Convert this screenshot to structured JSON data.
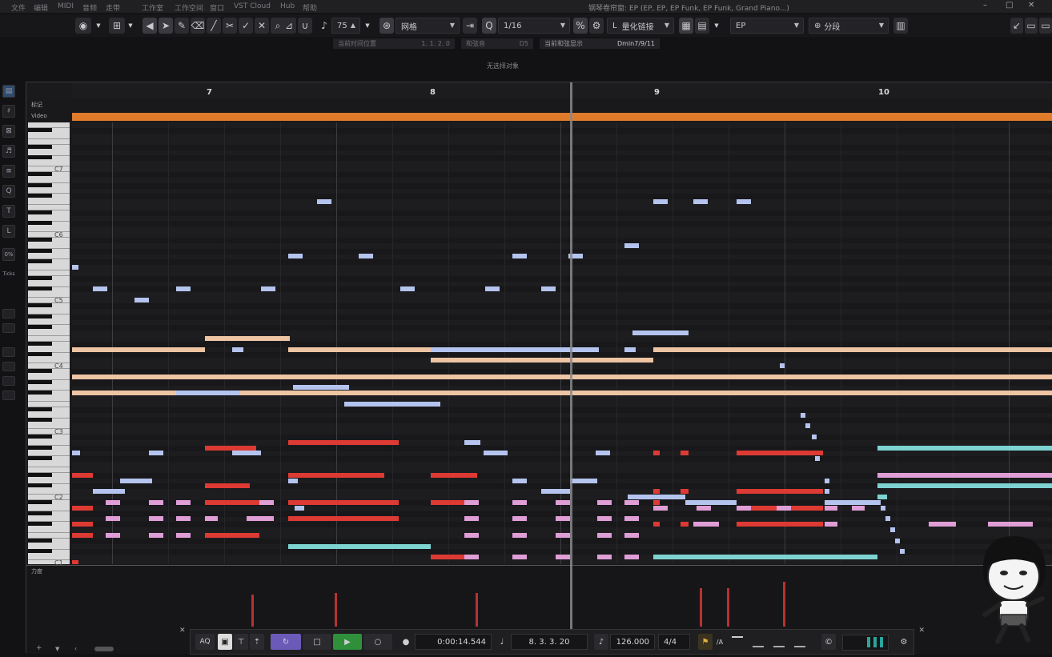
{
  "menu": [
    "文件",
    "编辑",
    "MIDI",
    "音频",
    "走带",
    "工作室",
    "工作空间",
    "窗口",
    "VST Cloud",
    "Hub",
    "帮助"
  ],
  "window_title": "钢琴卷帘窗: EP (EP, EP, EP Funk, EP Funk, Grand Piano...)",
  "toolbar": {
    "velocity_value": "75",
    "snap_type": "网格",
    "quantize_value": "1/16",
    "quantize_mode": "量化链接",
    "instrument": "EP",
    "segment_mode": "分段"
  },
  "infobar": {
    "insert_label": "当前时间位置",
    "insert_value": "1. 1. 2.   0",
    "chord_label": "和弦音",
    "chord_value": "D5",
    "current_chord_label": "当前和弦显示",
    "current_chord_value": "Dmin7/9/11"
  },
  "object_selection": "无选择对象",
  "left_tools": [
    "",
    "",
    "",
    "",
    "",
    "Q",
    "T",
    "L",
    "0%",
    "Ticks"
  ],
  "ruler": {
    "bars": [
      "7",
      "8",
      "9",
      "10"
    ]
  },
  "tracks": {
    "marker": "标记",
    "video": "Video"
  },
  "keyboard_labels": [
    "C7",
    "C6",
    "C5",
    "C4",
    "C3",
    "C2",
    "C1"
  ],
  "velocity_label": "力度",
  "transport": {
    "aq_label": "AQ",
    "time": "0:00:14.544",
    "bars_beats": "8. 3. 3. 20",
    "tempo": "126.000",
    "signature": "4/4"
  },
  "colors": {
    "salmon": "#eec4a3",
    "lavender": "#b5c4ee",
    "red": "#dd3a33",
    "pink": "#e09ed6",
    "cyan": "#7dd3d1",
    "yellow": "#e8e2ad",
    "orange": "#e07b2c"
  }
}
